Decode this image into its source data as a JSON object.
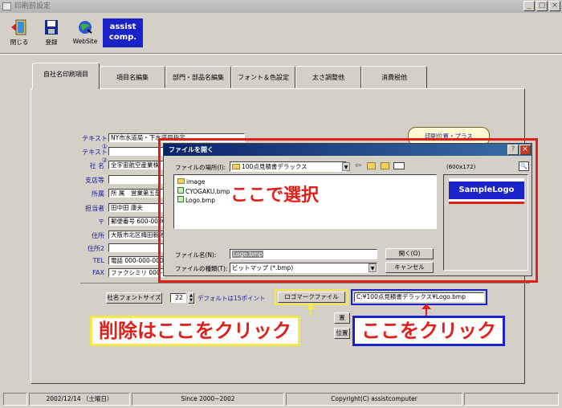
{
  "window": {
    "title": "印刷前設定"
  },
  "toolbar": {
    "close_label": "閉じる",
    "register_label": "登録",
    "website_label": "WebSite",
    "brand_line1": "assist",
    "brand_line2": "comp."
  },
  "tabs": [
    "自社名印刷項目",
    "項目名編集",
    "部門・部品名編集",
    "フォント＆色設定",
    "太さ調整他",
    "消費税他"
  ],
  "form": {
    "labels": [
      "テキスト①",
      "テキスト②",
      "社 名",
      "支店等",
      "所属",
      "担当者",
      "〒",
      "住所",
      "住所2",
      "TEL",
      "FAX"
    ],
    "values": [
      "NY市水道局・下水道局指定",
      "",
      "全宇宙航空産業株",
      "",
      "所 属　営業第五部",
      "田中田 康夫",
      "郵便番号 600-0000",
      "大阪市北区梅田新地",
      "",
      "電話 000-000-0000",
      "ファクシミリ 000-000-0000"
    ],
    "top_right_button": "印刷位置・プラス"
  },
  "font_size": {
    "button": "社名フォントサイズ",
    "value": "22",
    "hint": "デフォルトは15ポイント"
  },
  "logo": {
    "button": "ロゴマークファイル",
    "path": "C:¥100点見積書デラックス¥Logo.bmp"
  },
  "side_buttons": [
    "置",
    "位置"
  ],
  "dialog": {
    "title": "ファイルを開く",
    "location_label": "ファイルの場所(I):",
    "location_value": "100点見積書デラックス",
    "files": [
      "image",
      "CYOGAKU.bmp",
      "Logo.bmp"
    ],
    "filename_label": "ファイル名(N):",
    "filename_value": "Logo.bmp",
    "filetype_label": "ファイルの種類(T):",
    "filetype_value": "ビットマップ (*.bmp)",
    "open_button": "開く(O)",
    "cancel_button": "キャンセル",
    "preview_size": "(600x172)",
    "preview_logo": "SampleLogo"
  },
  "callouts": {
    "select_here": "ここで選択",
    "delete_here": "削除はここをクリック",
    "click_here": "ここをクリック"
  },
  "status_bar": [
    "2002/12/14 （土曜日）",
    "Since 2000~2002",
    "Copyright(C) assistcomputer"
  ],
  "colors": {
    "red": "#e0201a",
    "blue": "#1a23c8",
    "yellow": "#f4e84a",
    "accent_text": "#1a1aa0"
  }
}
